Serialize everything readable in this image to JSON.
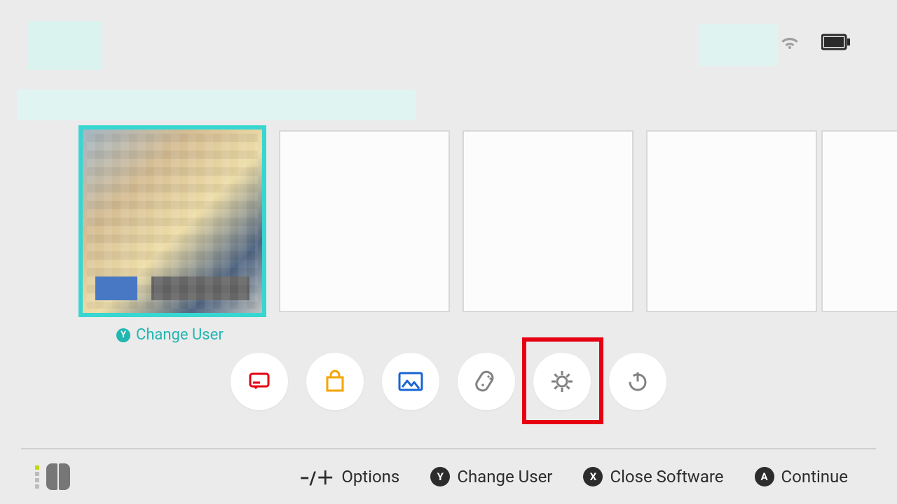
{
  "status": {
    "wifi_strength": 3,
    "battery_level": 95
  },
  "selected_tile": {
    "change_user_btn": "Y",
    "change_user_label": "Change User"
  },
  "dock": {
    "items": [
      {
        "id": "news",
        "name": "News"
      },
      {
        "id": "eshop",
        "name": "Nintendo eShop"
      },
      {
        "id": "album",
        "name": "Album"
      },
      {
        "id": "controllers",
        "name": "Controllers"
      },
      {
        "id": "settings",
        "name": "System Settings"
      },
      {
        "id": "sleep",
        "name": "Sleep Mode"
      }
    ],
    "highlighted_index": 4
  },
  "footer": {
    "options_glyph": "−/＋",
    "options_label": "Options",
    "change_user_btn": "Y",
    "change_user_label": "Change User",
    "close_btn": "X",
    "close_label": "Close Software",
    "continue_btn": "A",
    "continue_label": "Continue"
  }
}
